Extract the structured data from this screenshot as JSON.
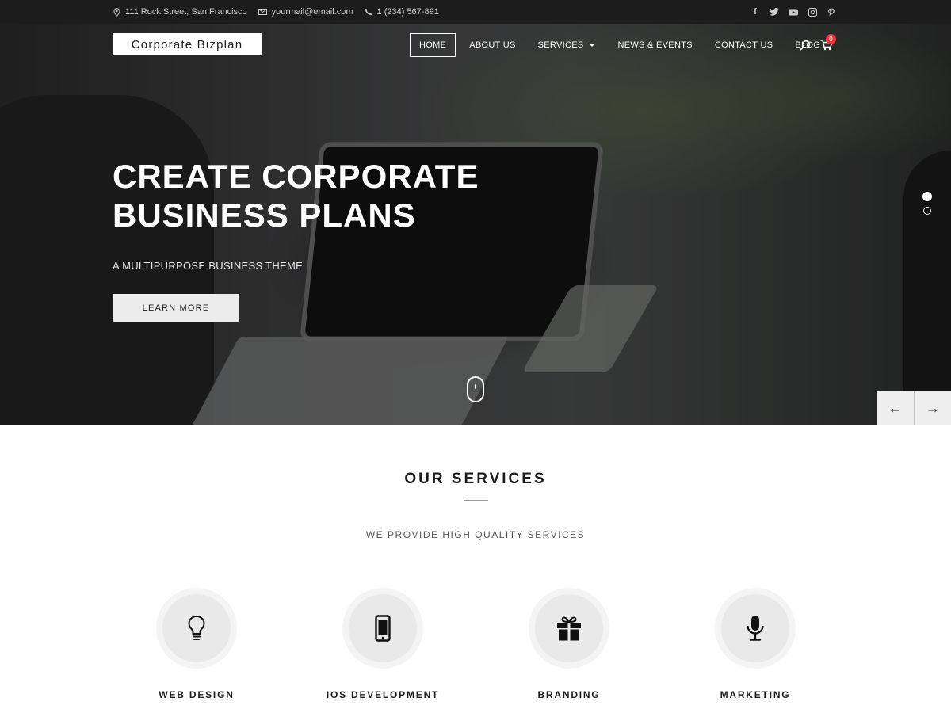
{
  "topbar": {
    "address": "111 Rock Street, San Francisco",
    "email": "yourmail@email.com",
    "phone": "1 (234) 567-891",
    "social_icons": [
      "facebook-icon",
      "twitter-icon",
      "youtube-icon",
      "instagram-icon",
      "pinterest-icon"
    ]
  },
  "header": {
    "logo": "Corporate Bizplan",
    "nav": [
      {
        "label": "HOME",
        "active": true
      },
      {
        "label": "ABOUT US"
      },
      {
        "label": "SERVICES",
        "has_dropdown": true
      },
      {
        "label": "NEWS & EVENTS"
      },
      {
        "label": "CONTACT US"
      },
      {
        "label": "BLOG"
      }
    ],
    "cart_count": "0"
  },
  "hero": {
    "title": "CREATE CORPORATE BUSINESS PLANS",
    "subtitle": "A MULTIPURPOSE BUSINESS THEME",
    "button": "LEARN MORE",
    "slides_total": 2,
    "active_slide": 1,
    "prev_arrow": "←",
    "next_arrow": "→"
  },
  "services": {
    "title": "OUR SERVICES",
    "subtitle": "WE PROVIDE HIGH QUALITY SERVICES",
    "items": [
      {
        "label": "WEB DESIGN",
        "icon": "lightbulb-icon"
      },
      {
        "label": "IOS DEVELOPMENT",
        "icon": "smartphone-icon"
      },
      {
        "label": "BRANDING",
        "icon": "gift-icon"
      },
      {
        "label": "MARKETING",
        "icon": "microphone-icon"
      }
    ]
  },
  "colors": {
    "topbar_bg": "#1c1c1c",
    "badge": "#e23b3b",
    "button_bg": "#ececec"
  }
}
